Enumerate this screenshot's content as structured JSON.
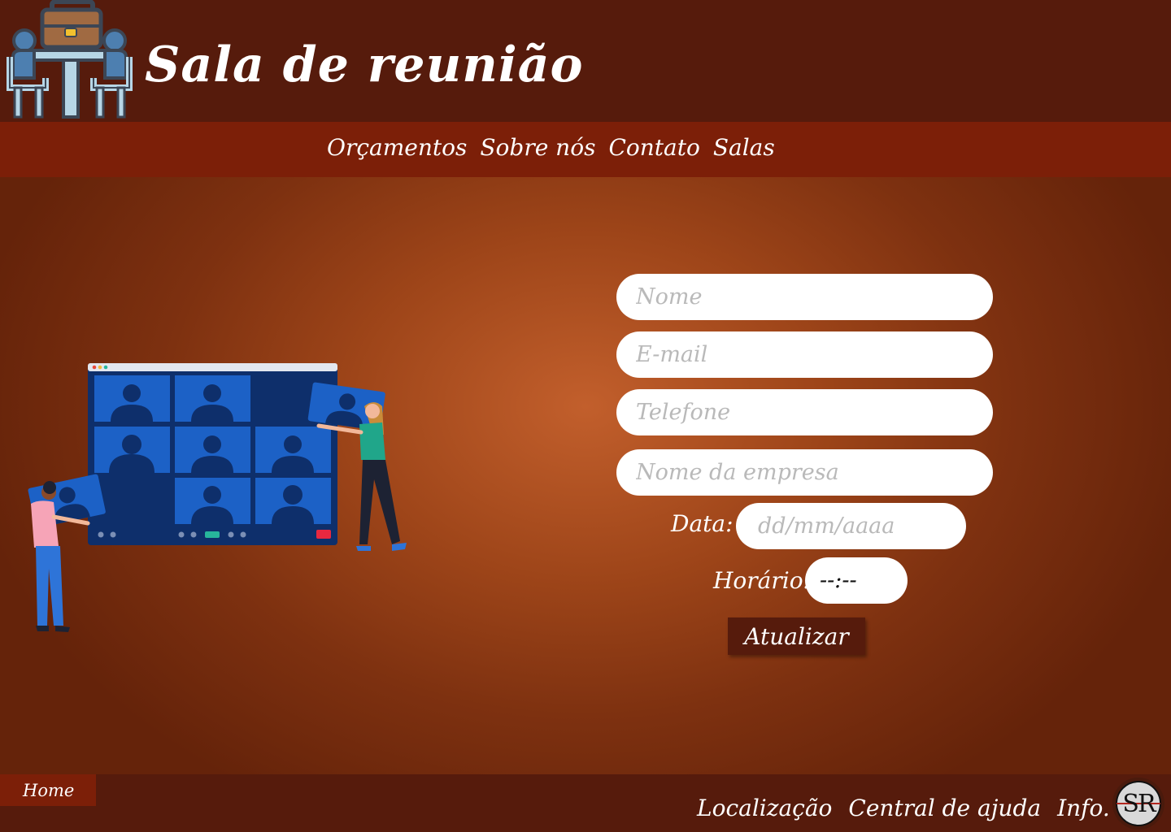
{
  "header": {
    "title": "Sala de reunião",
    "logo_icon": "meeting-table-briefcase-icon"
  },
  "nav": {
    "items": [
      {
        "label": "Orçamentos"
      },
      {
        "label": "Sobre nós"
      },
      {
        "label": "Contato"
      },
      {
        "label": "Salas"
      }
    ]
  },
  "illustration": {
    "icon": "video-conference-illustration"
  },
  "form": {
    "nome": {
      "placeholder": "Nome",
      "value": ""
    },
    "email": {
      "placeholder": "E-mail",
      "value": ""
    },
    "telefone": {
      "placeholder": "Telefone",
      "value": ""
    },
    "empresa": {
      "placeholder": "Nome da empresa",
      "value": ""
    },
    "data": {
      "label": "Data:",
      "placeholder": "dd/mm/aaaa"
    },
    "horario": {
      "label": "Horário:",
      "value": "--:--"
    },
    "submit_label": "Atualizar"
  },
  "footer": {
    "home_label": "Home",
    "links": [
      {
        "label": "Localização"
      },
      {
        "label": "Central de ajuda"
      },
      {
        "label": "Info."
      }
    ],
    "brand_text": "SR"
  },
  "colors": {
    "header_bg": "#561b0c",
    "nav_bg": "#7c1f08",
    "page_center": "#c25f2c",
    "page_edge": "#65230a",
    "field_bg": "#ffffff"
  }
}
